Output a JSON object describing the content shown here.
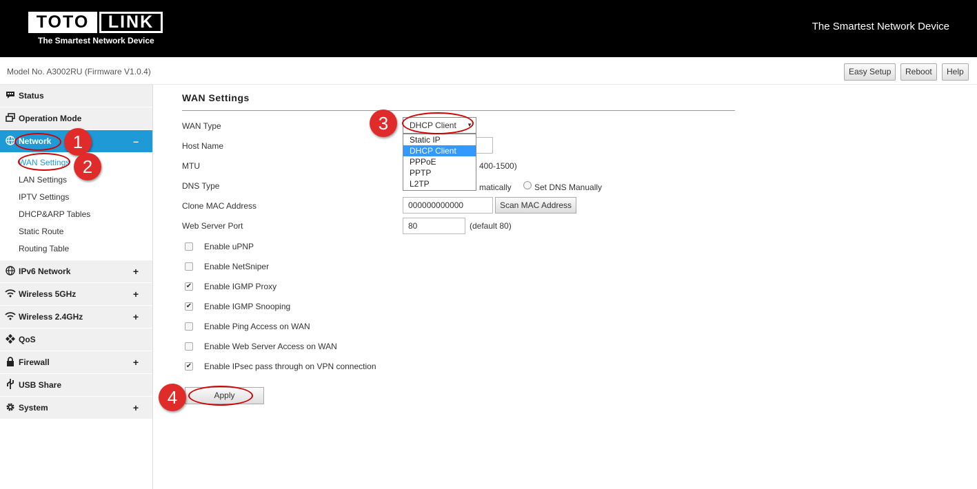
{
  "header": {
    "logo_left": "TOTO",
    "logo_right": "LINK",
    "logo_tagline": "The Smartest Network Device",
    "tagline": "The Smartest Network Device"
  },
  "modelbar": {
    "model_text": "Model No. A3002RU (Firmware V1.0.4)",
    "buttons": {
      "easy_setup": "Easy Setup",
      "reboot": "Reboot",
      "help": "Help"
    }
  },
  "sidebar": {
    "items": [
      {
        "label": "Status",
        "icon": "chat-icon"
      },
      {
        "label": "Operation Mode",
        "icon": "window-icon"
      },
      {
        "label": "Network",
        "icon": "globe-icon",
        "toggle": "–"
      },
      {
        "label": "IPv6 Network",
        "icon": "globe-icon",
        "toggle": "+"
      },
      {
        "label": "Wireless 5GHz",
        "icon": "wifi-icon",
        "toggle": "+"
      },
      {
        "label": "Wireless 2.4GHz",
        "icon": "wifi-icon",
        "toggle": "+"
      },
      {
        "label": "QoS",
        "icon": "qos-icon"
      },
      {
        "label": "Firewall",
        "icon": "lock-icon",
        "toggle": "+"
      },
      {
        "label": "USB Share",
        "icon": "usb-icon"
      },
      {
        "label": "System",
        "icon": "gear-icon",
        "toggle": "+"
      }
    ],
    "network_sub": [
      "WAN Settings",
      "LAN Settings",
      "IPTV Settings",
      "DHCP&ARP Tables",
      "Static Route",
      "Routing Table"
    ],
    "active_color": "#1e9bd7"
  },
  "main": {
    "title": "WAN Settings",
    "labels": {
      "wan_type": "WAN Type",
      "host_name": "Host Name",
      "mtu": "MTU",
      "dns_type": "DNS Type",
      "clone_mac": "Clone MAC Address",
      "web_port": "Web Server Port"
    },
    "wan_type": {
      "selected": "DHCP Client",
      "options": [
        "Static IP",
        "DHCP Client",
        "PPPoE",
        "PPTP",
        "L2TP"
      ]
    },
    "mtu_hint": "400-1500)",
    "dns_auto_partial": "matically",
    "dns_manual": "Set DNS Manually",
    "clone_mac_value": "000000000000",
    "scan_mac": "Scan MAC Address",
    "web_port_value": "80",
    "web_port_hint": "(default 80)",
    "checkboxes": [
      {
        "label": "Enable uPNP",
        "checked": false
      },
      {
        "label": "Enable NetSniper",
        "checked": false
      },
      {
        "label": "Enable IGMP Proxy",
        "checked": true
      },
      {
        "label": "Enable IGMP Snooping",
        "checked": true
      },
      {
        "label": "Enable Ping Access on WAN",
        "checked": false
      },
      {
        "label": "Enable Web Server Access on WAN",
        "checked": false
      },
      {
        "label": "Enable IPsec pass through on VPN connection",
        "checked": true
      }
    ],
    "apply": "Apply"
  },
  "annotations": {
    "m1": "1",
    "m2": "2",
    "m3": "3",
    "m4": "4",
    "color": "#e02b2b"
  }
}
